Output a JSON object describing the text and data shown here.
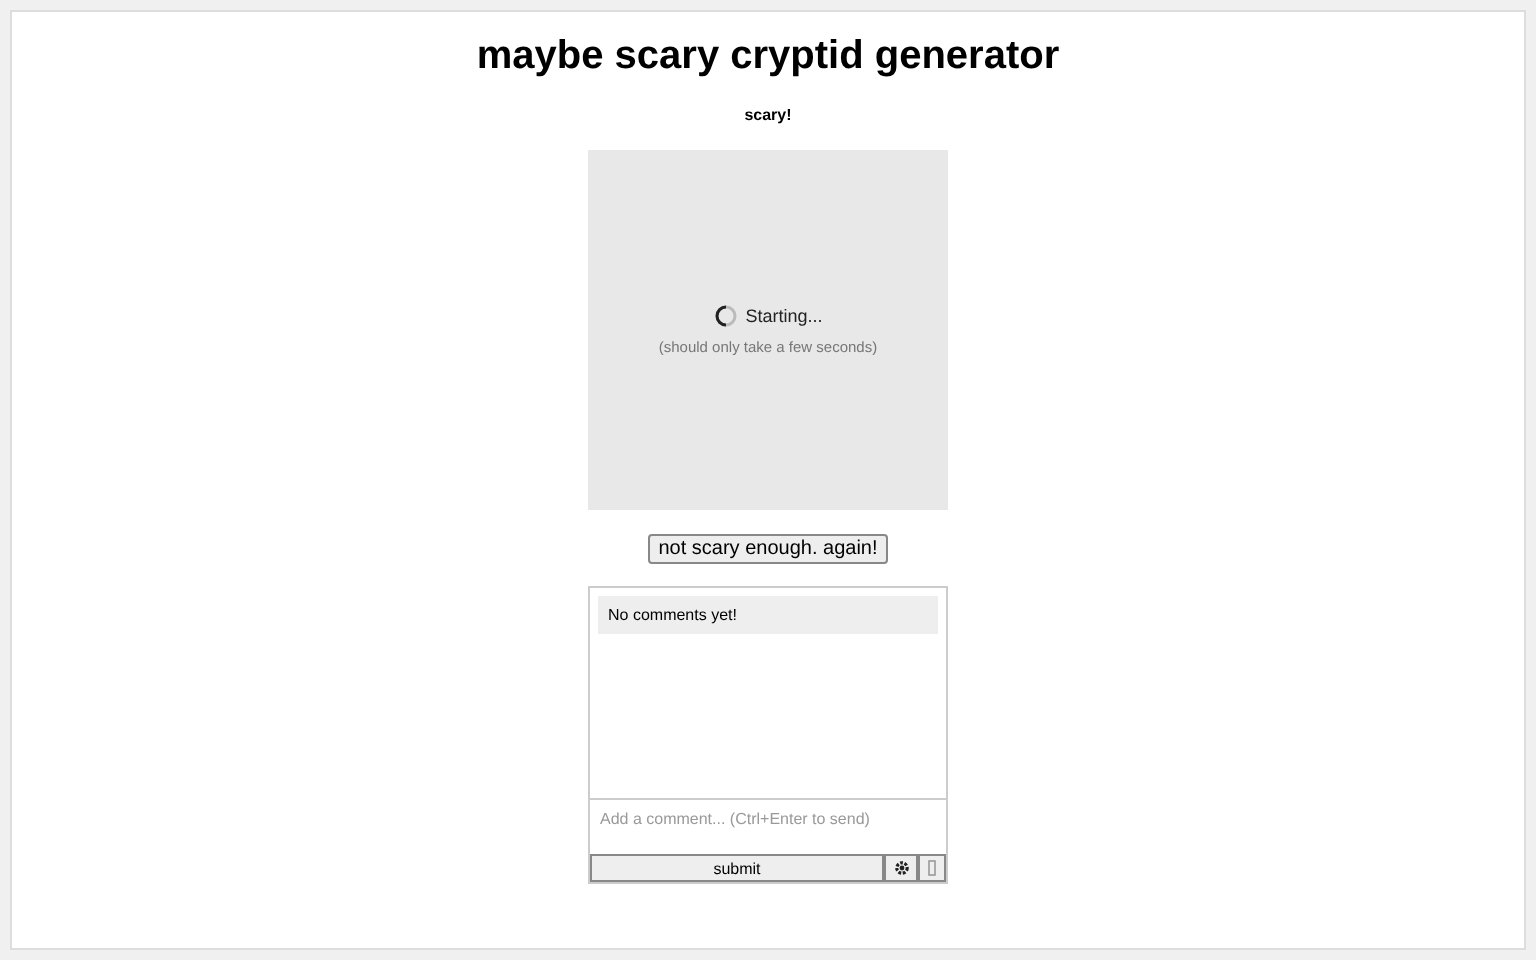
{
  "title": "maybe scary cryptid generator",
  "subtitle": "scary!",
  "loader": {
    "status": "Starting...",
    "hint": "(should only take a few seconds)"
  },
  "regenerate_button": "not scary enough. again!",
  "comments": {
    "empty_message": "No comments yet!",
    "placeholder": "Add a comment... (Ctrl+Enter to send)",
    "submit_button": "submit"
  }
}
